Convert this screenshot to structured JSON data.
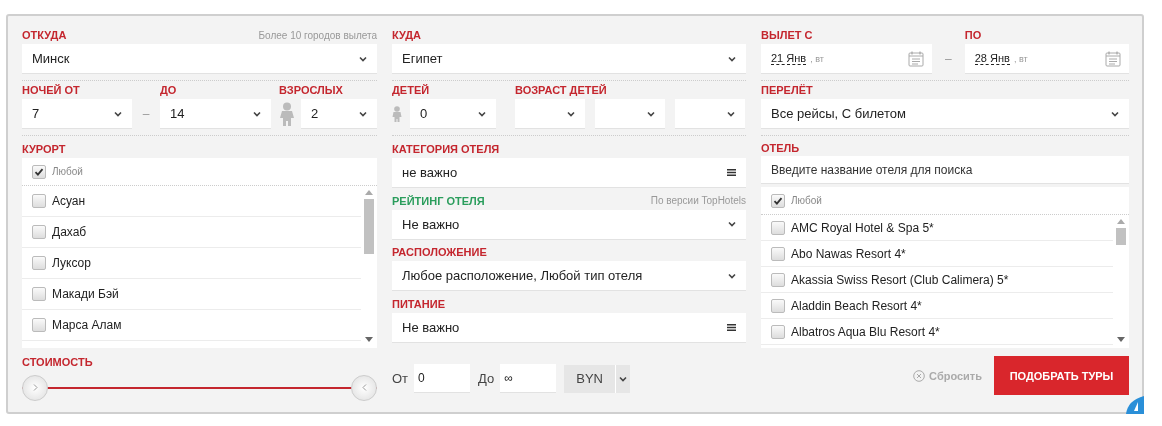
{
  "from": {
    "label": "ОТКУДА",
    "hint": "Более 10 городов вылета",
    "value": "Минск"
  },
  "to": {
    "label": "КУДА",
    "value": "Египет"
  },
  "dates": {
    "label_from": "ВЫЛЕТ С",
    "label_to": "ПО",
    "separator": "–",
    "from": {
      "date": "21 Янв",
      "weekday": ", вт"
    },
    "to": {
      "date": "28 Янв",
      "weekday": ", вт"
    }
  },
  "nights": {
    "from_label": "НОЧЕЙ ОТ",
    "from": "7",
    "separator": "–",
    "to_label": "ДО",
    "to": "14"
  },
  "adults": {
    "label": "ВЗРОСЛЫХ",
    "value": "2"
  },
  "children": {
    "label": "ДЕТЕЙ",
    "value": "0"
  },
  "child_ages": {
    "label": "ВОЗРАСТ ДЕТЕЙ",
    "fields": [
      {
        "kind": "select"
      },
      {
        "kind": "select"
      },
      {
        "kind": "select"
      }
    ]
  },
  "flight": {
    "label": "ПЕРЕЛЁТ",
    "value": "Все рейсы, С билетом"
  },
  "resort": {
    "label": "КУРОРТ",
    "any": {
      "label": "Любой",
      "checked": true
    },
    "items": [
      {
        "name": "Асуан",
        "checked": false
      },
      {
        "name": "Дахаб",
        "checked": false
      },
      {
        "name": "Луксор",
        "checked": false
      },
      {
        "name": "Макади Бэй",
        "checked": false
      },
      {
        "name": "Марса Алам",
        "checked": false
      }
    ]
  },
  "middle_fields": [
    {
      "label": "КАТЕГОРИЯ ОТЕЛЯ",
      "value": "не важно",
      "kind": "multi"
    },
    {
      "label": "РЕЙТИНГ ОТЕЛЯ",
      "color": "#2a9d5c",
      "hint": "По версии TopHotels",
      "value": "Не важно",
      "kind": "select"
    },
    {
      "label": "РАСПОЛОЖЕНИЕ",
      "value": "Любое расположение, Любой тип отеля",
      "kind": "select"
    },
    {
      "label": "ПИТАНИЕ",
      "value": "Не важно",
      "kind": "multi"
    }
  ],
  "hotel": {
    "label": "ОТЕЛЬ",
    "placeholder": "Введите название отеля для поиска",
    "any": {
      "label": "Любой",
      "checked": true
    },
    "items": [
      {
        "name": "AMC Royal Hotel & Spa 5*",
        "checked": false
      },
      {
        "name": "Abo Nawas Resort 4*",
        "checked": false
      },
      {
        "name": "Akassia Swiss Resort (Club Calimera) 5*",
        "checked": false
      },
      {
        "name": "Aladdin Beach Resort 4*",
        "checked": false
      },
      {
        "name": "Albatros Aqua Blu Resort 4*",
        "checked": false
      }
    ]
  },
  "price": {
    "label": "СТОИМОСТЬ",
    "thumbs": [
      {
        "level": 0
      },
      {
        "level": 1
      }
    ],
    "from_label": "От",
    "from": "0",
    "to_label": "До",
    "to": "∞",
    "currency": "BYN"
  },
  "actions": {
    "reset": "Сбросить",
    "submit": "ПОДОБРАТЬ ТУРЫ"
  }
}
